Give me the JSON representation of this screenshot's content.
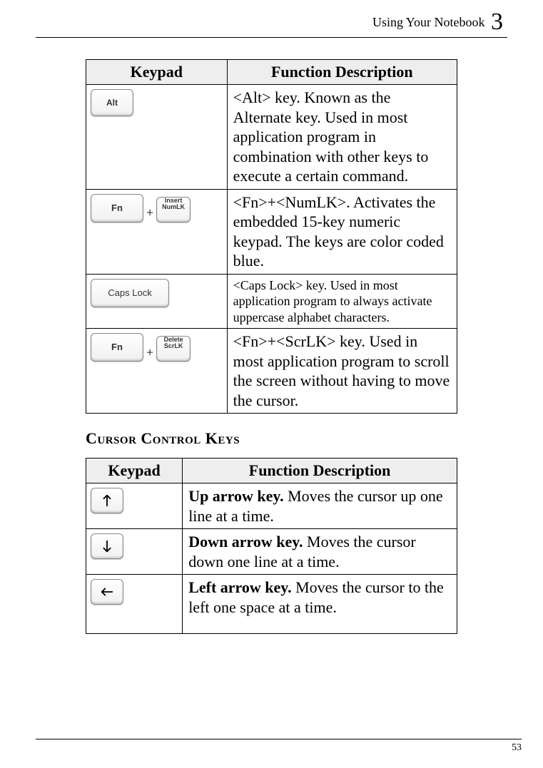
{
  "running_head": {
    "title": "Using Your Notebook",
    "chapter_number": "3"
  },
  "page_number": "53",
  "table1": {
    "headers": {
      "col1": "Keypad",
      "col2": "Function Description"
    },
    "rows": [
      {
        "key_labels": {
          "k1": "Alt"
        },
        "desc": "<Alt> key. Known as the Alternate key. Used in most application program in combination with other keys to execute a certain command."
      },
      {
        "key_labels": {
          "k1": "Fn",
          "plus": "+",
          "k2": "Insert\nNumLK"
        },
        "desc": "<Fn>+<NumLK>. Activates the embedded 15-key numeric keypad. The keys are color coded blue."
      },
      {
        "key_labels": {
          "k1": "Caps Lock"
        },
        "desc": "<Caps Lock> key. Used in most application program to always activate uppercase alphabet characters."
      },
      {
        "key_labels": {
          "k1": "Fn",
          "plus": "+",
          "k2": "Delete\nScrLK"
        },
        "desc": "<Fn>+<ScrLK> key. Used in most application program to scroll the screen without having to move the cursor."
      }
    ]
  },
  "section_heading": "Cursor Control Keys",
  "table2": {
    "headers": {
      "col1": "Keypad",
      "col2": "Function Description"
    },
    "rows": [
      {
        "icon": "up",
        "bold": "Up arrow key.",
        "rest": " Moves the cursor up one line at a time."
      },
      {
        "icon": "down",
        "bold": "Down arrow key.",
        "rest": " Moves the cursor down one line at a time."
      },
      {
        "icon": "left",
        "bold": "Left arrow key.",
        "rest": " Moves the cursor to the left one space at a time."
      }
    ]
  }
}
